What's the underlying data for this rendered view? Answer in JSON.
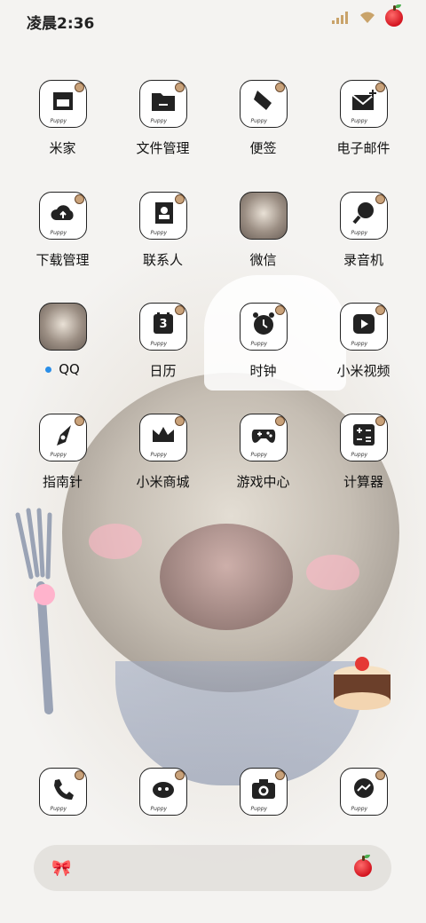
{
  "status_bar": {
    "time": "凌晨2:36"
  },
  "apps_grid": [
    {
      "id": "mijia",
      "label": "米家",
      "icon": "house-icon"
    },
    {
      "id": "files",
      "label": "文件管理",
      "icon": "folder-icon"
    },
    {
      "id": "notes",
      "label": "便签",
      "icon": "note-icon"
    },
    {
      "id": "email",
      "label": "电子邮件",
      "icon": "mail-icon"
    },
    {
      "id": "downloads",
      "label": "下载管理",
      "icon": "cloud-download-icon"
    },
    {
      "id": "contacts",
      "label": "联系人",
      "icon": "contacts-icon"
    },
    {
      "id": "wechat",
      "label": "微信",
      "icon": "dog-photo-icon"
    },
    {
      "id": "recorder",
      "label": "录音机",
      "icon": "microphone-icon"
    },
    {
      "id": "qq",
      "label": "QQ",
      "icon": "dog-photo-icon",
      "badge_dot": true
    },
    {
      "id": "calendar",
      "label": "日历",
      "icon": "calendar-icon",
      "calendar_day": "3"
    },
    {
      "id": "clock",
      "label": "时钟",
      "icon": "alarm-clock-icon"
    },
    {
      "id": "mi_video",
      "label": "小米视频",
      "icon": "play-icon"
    },
    {
      "id": "compass",
      "label": "指南针",
      "icon": "compass-icon"
    },
    {
      "id": "mi_store",
      "label": "小米商城",
      "icon": "crown-icon"
    },
    {
      "id": "game_center",
      "label": "游戏中心",
      "icon": "gamepad-icon"
    },
    {
      "id": "calculator",
      "label": "计算器",
      "icon": "calculator-icon"
    }
  ],
  "icon_tag": "Puppy",
  "dock_apps": [
    {
      "id": "phone",
      "icon": "phone-icon"
    },
    {
      "id": "browser",
      "icon": "hedgehog-icon"
    },
    {
      "id": "camera",
      "icon": "camera-icon"
    },
    {
      "id": "messages",
      "icon": "message-icon"
    }
  ],
  "colors": {
    "badge_dot": "#2a8ee8",
    "text": "#111111"
  }
}
